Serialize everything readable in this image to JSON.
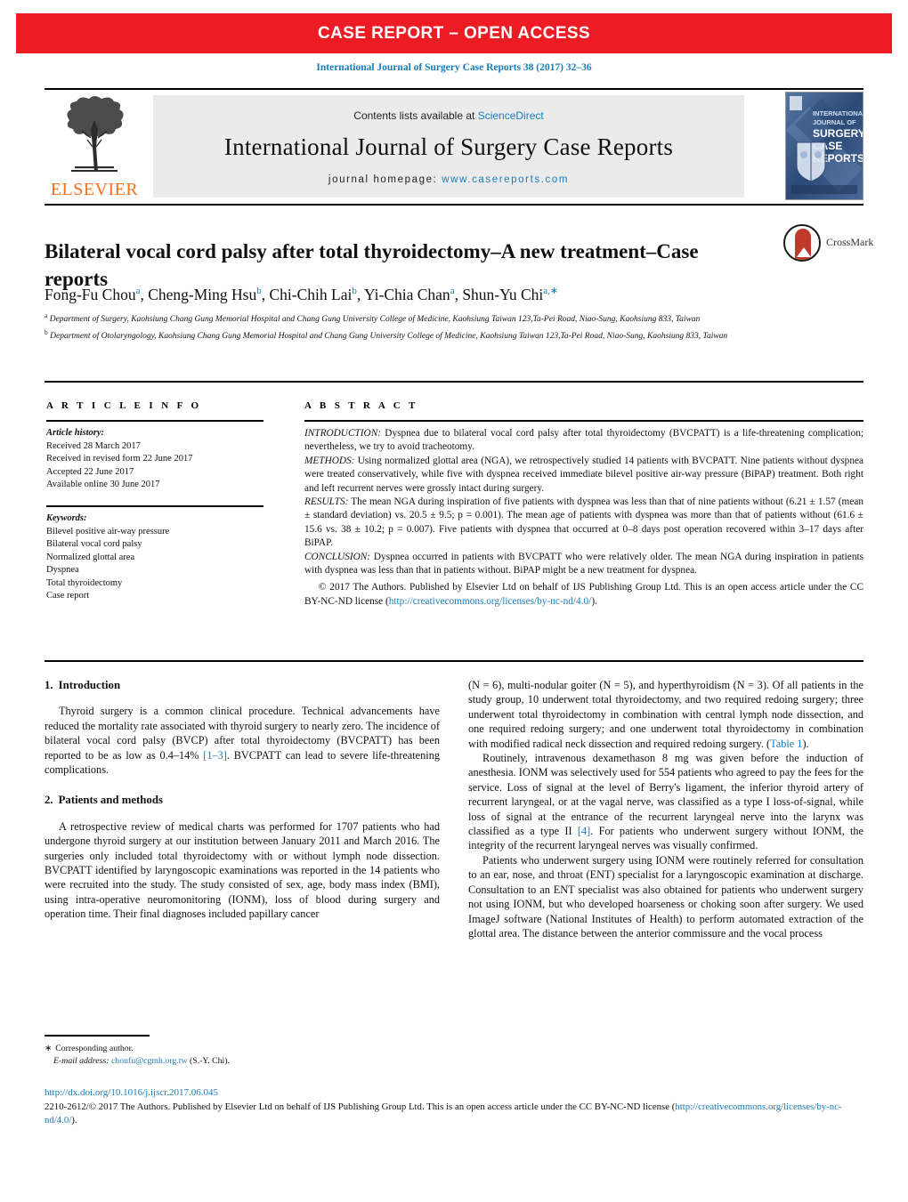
{
  "banner": {
    "text": "CASE REPORT – OPEN ACCESS"
  },
  "citation": {
    "text": "International Journal of Surgery Case Reports 38 (2017) 32–36"
  },
  "masthead": {
    "contents_prefix": "Contents lists available at ",
    "sciencedirect": "ScienceDirect",
    "journal_title": "International Journal of Surgery Case Reports",
    "homepage_prefix": "journal homepage: ",
    "homepage_url": "www.casereports.com",
    "elsevier": "ELSEVIER",
    "cover_lines": [
      "INTERNATIONAL",
      "JOURNAL OF",
      "SURGERY",
      "CASE",
      "REPORTS"
    ]
  },
  "article": {
    "title": "Bilateral vocal cord palsy after total thyroidectomy–A new treatment–Case reports",
    "crossmark_label": "CrossMark",
    "authors": [
      {
        "name": "Fong-Fu Chou",
        "sup": "a",
        "sep": ", "
      },
      {
        "name": "Cheng-Ming Hsu",
        "sup": "b",
        "sep": ", "
      },
      {
        "name": "Chi-Chih Lai",
        "sup": "b",
        "sep": ", "
      },
      {
        "name": "Yi-Chia Chan",
        "sup": "a",
        "sep": ", "
      },
      {
        "name": "Shun-Yu Chi",
        "sup": "a,∗",
        "sep": ""
      }
    ],
    "affiliation_a": "Department of Surgery, Kaohsiung Chang Gung Memorial Hospital and Chang Gung University College of Medicine, Kaohsiung Taiwan 123,Ta-Pei Road, Niao-Sung, Kaohsiung 833, Taiwan",
    "affiliation_b": "Department of Otolaryngology, Kaohsiung Chang Gung Memorial Hospital and Chang Gung University College of Medicine, Kaohsiung Taiwan 123,Ta-Pei Road, Niao-Sung, Kaohsiung 833, Taiwan"
  },
  "article_info": {
    "heading": "A R T I C L E   I N F O",
    "history_label": "Article history:",
    "history": [
      "Received 28 March 2017",
      "Received in revised form 22 June 2017",
      "Accepted 22 June 2017",
      "Available online 30 June 2017"
    ],
    "keywords_label": "Keywords:",
    "keywords": [
      "Bilevel positive air-way pressure",
      "Bilateral vocal cord palsy",
      "Normalized glottal area",
      "Dyspnea",
      "Total thyroidectomy",
      "Case report"
    ]
  },
  "abstract": {
    "heading": "A B S T R A C T",
    "sections": [
      {
        "label": "INTRODUCTION:",
        "text": " Dyspnea due to bilateral vocal cord palsy after total thyroidectomy (BVCPATT) is a life-threatening complication; nevertheless, we try to avoid tracheotomy."
      },
      {
        "label": "METHODS:",
        "text": " Using normalized glottal area (NGA), we retrospectively studied 14 patients with BVCPATT. Nine patients without dyspnea were treated conservatively, while five with dyspnea received immediate bilevel positive air-way pressure (BiPAP) treatment. Both right and left recurrent nerves were grossly intact during surgery."
      },
      {
        "label": "RESULTS:",
        "text": " The mean NGA during inspiration of five patients with dyspnea was less than that of nine patients without (6.21 ± 1.57 (mean ± standard deviation) vs. 20.5 ± 9.5; p = 0.001). The mean age of patients with dyspnea was more than that of patients without (61.6 ± 15.6 vs. 38 ± 10.2; p = 0.007). Five patients with dyspnea that occurred at 0–8 days post operation recovered within 3–17 days after BiPAP."
      },
      {
        "label": "CONCLUSION:",
        "text": " Dyspnea occurred in patients with BVCPATT who were relatively older. The mean NGA during inspiration in patients with dyspnea was less than that in patients without. BiPAP might be a new treatment for dyspnea."
      }
    ],
    "copyright_pre": "© 2017 The Authors. Published by Elsevier Ltd on behalf of IJS Publishing Group Ltd. This is an open access article under the CC BY-NC-ND license (",
    "copyright_link": "http://creativecommons.org/licenses/by-nc-nd/4.0/",
    "copyright_post": ")."
  },
  "body": {
    "section1_num": "1.",
    "section1_title": "Introduction",
    "section1_p1_a": "Thyroid surgery is a common clinical procedure. Technical advancements have reduced the mortality rate associated with thyroid surgery to nearly zero. The incidence of bilateral vocal cord palsy (BVCP) after total thyroidectomy (BVCPATT) has been reported to be as low as 0.4–14% ",
    "section1_ref": "[1–3]",
    "section1_p1_b": ". BVCPATT can lead to severe life-threatening complications.",
    "section2_num": "2.",
    "section2_title": "Patients and methods",
    "section2_p1": "A retrospective review of medical charts was performed for 1707 patients who had undergone thyroid surgery at our institution between January 2011 and March 2016. The surgeries only included total thyroidectomy with or without lymph node dissection. BVCPATT identified by laryngoscopic examinations was reported in the 14 patients who were recruited into the study. The study consisted of sex, age, body mass index (BMI), using intra-operative neuromonitoring (IONM), loss of blood during surgery and operation time. Their final diagnoses included papillary cancer",
    "right_p1_a": "(N = 6), multi-nodular goiter (N = 5), and hyperthyroidism (N = 3). Of all patients in the study group, 10 underwent total thyroidectomy, and two required redoing surgery; three underwent total thyroidectomy in combination with central lymph node dissection, and one required redoing surgery; and one underwent total thyroidectomy in combination with modified radical neck dissection and required redoing surgery. (",
    "right_p1_ref": "Table 1",
    "right_p1_b": ").",
    "right_p2_a": "Routinely, intravenous dexamethason 8 mg was given before the induction of anesthesia. IONM was selectively used for 554 patients who agreed to pay the fees for the service. Loss of signal at the level of Berry's ligament, the inferior thyroid artery of recurrent laryngeal, or at the vagal nerve, was classified as a type I loss-of-signal, while loss of signal at the entrance of the recurrent laryngeal nerve into the larynx was classified as a type II ",
    "right_p2_ref": "[4]",
    "right_p2_b": ". For patients who underwent surgery without IONM, the integrity of the recurrent laryngeal nerves was visually confirmed.",
    "right_p3": "Patients who underwent surgery using IONM were routinely referred for consultation to an ear, nose, and throat (ENT) specialist for a laryngoscopic examination at discharge. Consultation to an ENT specialist was also obtained for patients who underwent surgery not using IONM, but who developed hoarseness or choking soon after surgery. We used ImageJ software (National Institutes of Health) to perform automated extraction of the glottal area. The distance between the anterior commissure and the vocal process"
  },
  "footer": {
    "star": "∗",
    "corresponding": "Corresponding author.",
    "email_label": "E-mail address:",
    "email": "choufu@cgmh.org.tw",
    "email_owner": "(S.-Y. Chi).",
    "doi": "http://dx.doi.org/10.1016/j.ijscr.2017.06.045",
    "copyright_pre": "2210-2612/© 2017 The Authors. Published by Elsevier Ltd on behalf of IJS Publishing Group Ltd. This is an open access article under the CC BY-NC-ND license (",
    "copyright_link": "http://creativecommons.org/licenses/by-nc-nd/4.0/",
    "copyright_post": ")."
  }
}
